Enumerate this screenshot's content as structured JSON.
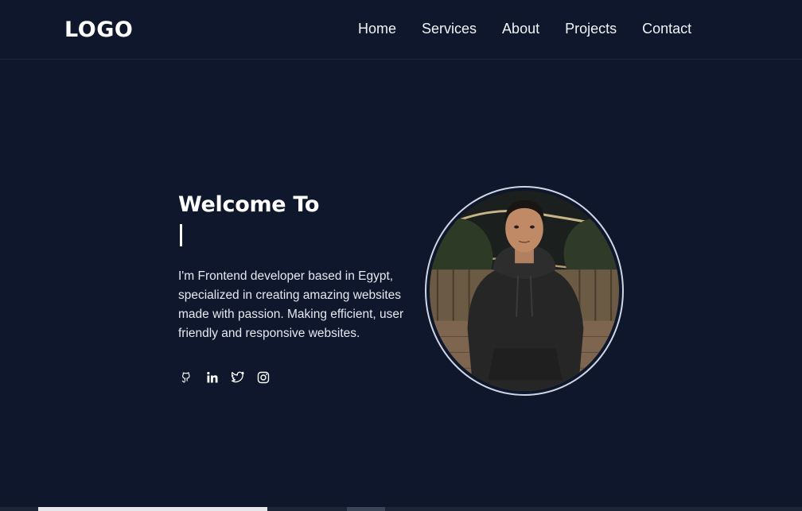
{
  "header": {
    "logo": "LOGO",
    "nav": [
      {
        "label": "Home"
      },
      {
        "label": "Services"
      },
      {
        "label": "About"
      },
      {
        "label": "Projects"
      },
      {
        "label": "Contact"
      }
    ]
  },
  "hero": {
    "title": "Welcome To",
    "typed_text": "",
    "description": "I'm Frontend developer based in Egypt, specialized in creating amazing websites made with passion. Making efficient, user friendly and responsive websites.",
    "socials": [
      {
        "icon": "github-icon"
      },
      {
        "icon": "linkedin-icon"
      },
      {
        "icon": "twitter-icon"
      },
      {
        "icon": "instagram-icon"
      }
    ]
  },
  "colors": {
    "background": "#0e172b",
    "text": "#ffffff",
    "avatar_border": "#cfd6e4"
  }
}
